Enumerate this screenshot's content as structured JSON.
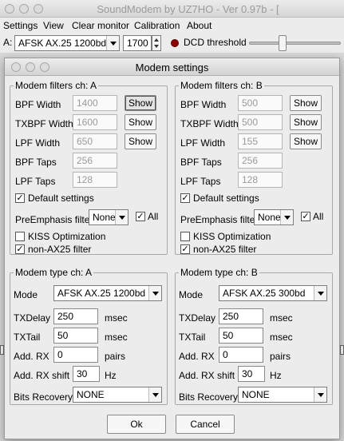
{
  "main_window": {
    "title": "SoundModem by UZ7HO - Ver 0.97b - [",
    "menu": [
      {
        "label": "Settings"
      },
      {
        "label": "View"
      },
      {
        "label": "Clear monitor"
      },
      {
        "label": "Calibration"
      },
      {
        "label": "About"
      }
    ],
    "channel_label": "A:",
    "mode_value": "AFSK AX.25 1200bd",
    "freq_value": "1700",
    "dcd_label": "DCD threshold",
    "dcd_led_color": "#8b0000",
    "dcd_threshold_level": 0.35
  },
  "dialog": {
    "title": "Modem settings",
    "ok_label": "Ok",
    "cancel_label": "Cancel",
    "filters_a": {
      "title": "Modem filters ch: A",
      "bpf_width_label": "BPF Width",
      "bpf_width": "1400",
      "txbpf_width_label": "TXBPF Width",
      "txbpf_width": "1600",
      "lpf_width_label": "LPF Width",
      "lpf_width": "650",
      "bpf_taps_label": "BPF Taps",
      "bpf_taps": "256",
      "lpf_taps_label": "LPF Taps",
      "lpf_taps": "128",
      "show_label": "Show",
      "default_settings_label": "Default settings",
      "default_settings_checked": true,
      "preemphasis_label": "PreEmphasis filter",
      "preemphasis_value": "None",
      "all_label": "All",
      "all_checked": true,
      "kiss_label": "KISS Optimization",
      "kiss_checked": false,
      "nonax25_label": "non-AX25 filter",
      "nonax25_checked": true
    },
    "filters_b": {
      "title": "Modem filters ch: B",
      "bpf_width_label": "BPF Width",
      "bpf_width": "500",
      "txbpf_width_label": "TXBPF Width",
      "txbpf_width": "500",
      "lpf_width_label": "LPF Width",
      "lpf_width": "155",
      "bpf_taps_label": "BPF Taps",
      "bpf_taps": "256",
      "lpf_taps_label": "LPF Taps",
      "lpf_taps": "128",
      "show_label": "Show",
      "default_settings_label": "Default settings",
      "default_settings_checked": true,
      "preemphasis_label": "PreEmphasis filter",
      "preemphasis_value": "None",
      "all_label": "All",
      "all_checked": true,
      "kiss_label": "KISS Optimization",
      "kiss_checked": false,
      "nonax25_label": "non-AX25 filter",
      "nonax25_checked": true
    },
    "type_a": {
      "title": "Modem type ch: A",
      "mode_label": "Mode",
      "mode_value": "AFSK AX.25 1200bd",
      "txdelay_label": "TXDelay",
      "txdelay": "250",
      "txdelay_unit": "msec",
      "txtail_label": "TXTail",
      "txtail": "50",
      "txtail_unit": "msec",
      "addrx_label": "Add. RX",
      "addrx": "0",
      "addrx_unit": "pairs",
      "addrxshift_label": "Add. RX shift",
      "addrxshift": "30",
      "addrxshift_unit": "Hz",
      "bits_label": "Bits Recovery",
      "bits_value": "NONE"
    },
    "type_b": {
      "title": "Modem type ch: B",
      "mode_label": "Mode",
      "mode_value": "AFSK AX.25 300bd",
      "txdelay_label": "TXDelay",
      "txdelay": "250",
      "txdelay_unit": "msec",
      "txtail_label": "TXTail",
      "txtail": "50",
      "txtail_unit": "msec",
      "addrx_label": "Add. RX",
      "addrx": "0",
      "addrx_unit": "pairs",
      "addrxshift_label": "Add. RX shift",
      "addrxshift": "30",
      "addrxshift_unit": "Hz",
      "bits_label": "Bits Recovery",
      "bits_value": "NONE"
    }
  }
}
